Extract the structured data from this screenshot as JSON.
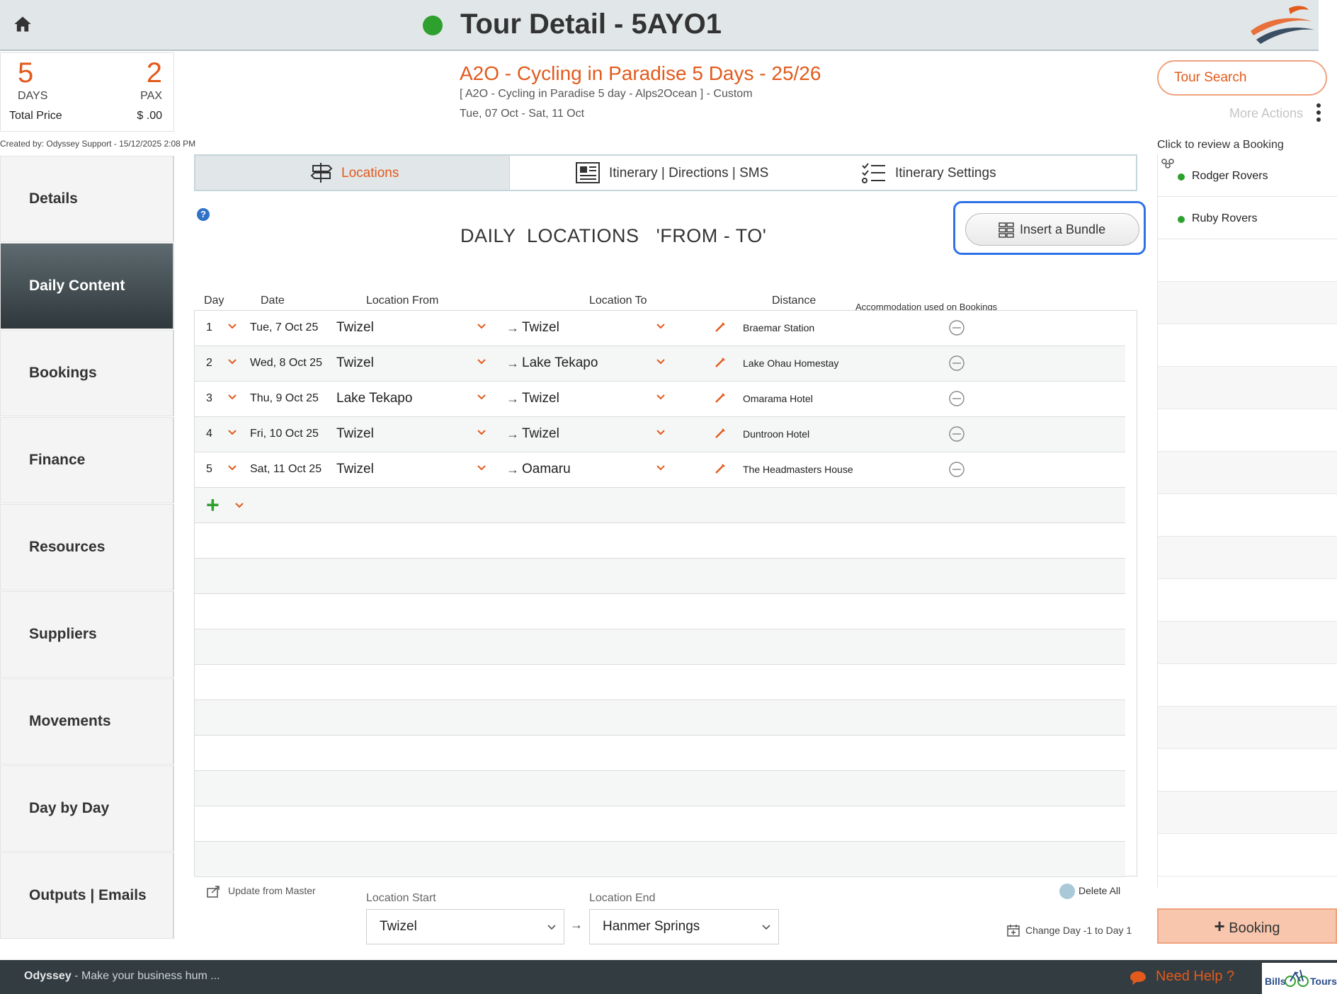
{
  "header": {
    "title": "Tour Detail - 5AYO1",
    "status_color": "#2ea02e",
    "home_icon": "home-icon",
    "logo_icon": "brand-swoosh-logo"
  },
  "summary": {
    "days_value": "5",
    "days_label": "DAYS",
    "pax_value": "2",
    "pax_label": "PAX",
    "price_label": "Total Price",
    "price_value": "$ .00"
  },
  "created_by": "Created by: Odyssey Support - 15/12/2025 2:08 PM",
  "tour": {
    "name": "A2O - Cycling in Paradise 5 Days - 25/26",
    "subtitle": "[ A2O - Cycling in Paradise 5 day - Alps2Ocean ] - Custom",
    "dates": "Tue, 07 Oct  - Sat, 11 Oct"
  },
  "right": {
    "tour_search_label": "Tour Search",
    "more_actions_label": "More Actions",
    "review_label": "Click to review a Booking",
    "bookings": [
      "Rodger Rovers",
      "Ruby Rovers"
    ],
    "add_booking_label": "Booking"
  },
  "nav": {
    "items": [
      {
        "label": "Details"
      },
      {
        "label": "Daily Content"
      },
      {
        "label": "Bookings"
      },
      {
        "label": "Finance"
      },
      {
        "label": "Resources"
      },
      {
        "label": "Suppliers"
      },
      {
        "label": "Movements"
      },
      {
        "label": "Day by Day"
      },
      {
        "label": "Outputs | Emails"
      }
    ],
    "active": "Daily Content"
  },
  "tabs": [
    {
      "label": "Locations",
      "icon": "signpost-icon"
    },
    {
      "label": "Itinerary | Directions | SMS",
      "icon": "newspaper-icon"
    },
    {
      "label": "Itinerary Settings",
      "icon": "checklist-icon"
    }
  ],
  "section": {
    "title": "DAILY  LOCATIONS   'FROM - TO'",
    "insert_bundle_label": "Insert a Bundle"
  },
  "table": {
    "headers": {
      "day": "Day",
      "date": "Date",
      "from": "Location From",
      "to": "Location To",
      "distance": "Distance",
      "accommodation": "Accommodation used on Bookings"
    },
    "rows": [
      {
        "day": "1",
        "date": "Tue, 7 Oct 25",
        "from": "Twizel",
        "to": "Twizel",
        "accommodation": "Braemar Station"
      },
      {
        "day": "2",
        "date": "Wed, 8 Oct 25",
        "from": "Twizel",
        "to": "Lake Tekapo",
        "accommodation": "Lake Ohau Homestay"
      },
      {
        "day": "3",
        "date": "Thu, 9 Oct 25",
        "from": "Lake Tekapo",
        "to": "Twizel",
        "accommodation": "Omarama Hotel"
      },
      {
        "day": "4",
        "date": "Fri, 10 Oct 25",
        "from": "Twizel",
        "to": "Twizel",
        "accommodation": "Duntroon Hotel"
      },
      {
        "day": "5",
        "date": "Sat, 11 Oct 25",
        "from": "Twizel",
        "to": "Oamaru",
        "accommodation": "The Headmasters House"
      }
    ],
    "arrow_glyph": "→",
    "add_glyph": "+"
  },
  "footer": {
    "update_from_master": "Update from Master",
    "location_start_label": "Location Start",
    "location_start_value": "Twizel",
    "location_end_label": "Location End",
    "location_end_value": "Hanmer Springs",
    "delete_all": "Delete All",
    "change_day": "Change Day -1 to Day 1"
  },
  "bottombar": {
    "brand": "Odyssey",
    "tagline": " - Make your business hum ...",
    "need_help": "Need Help ?",
    "partner_a": "Bills",
    "partner_b": "Tours"
  },
  "colors": {
    "accent": "#e25a1c",
    "active_nav": "#3a4448",
    "focus_ring": "#2f72e8"
  }
}
